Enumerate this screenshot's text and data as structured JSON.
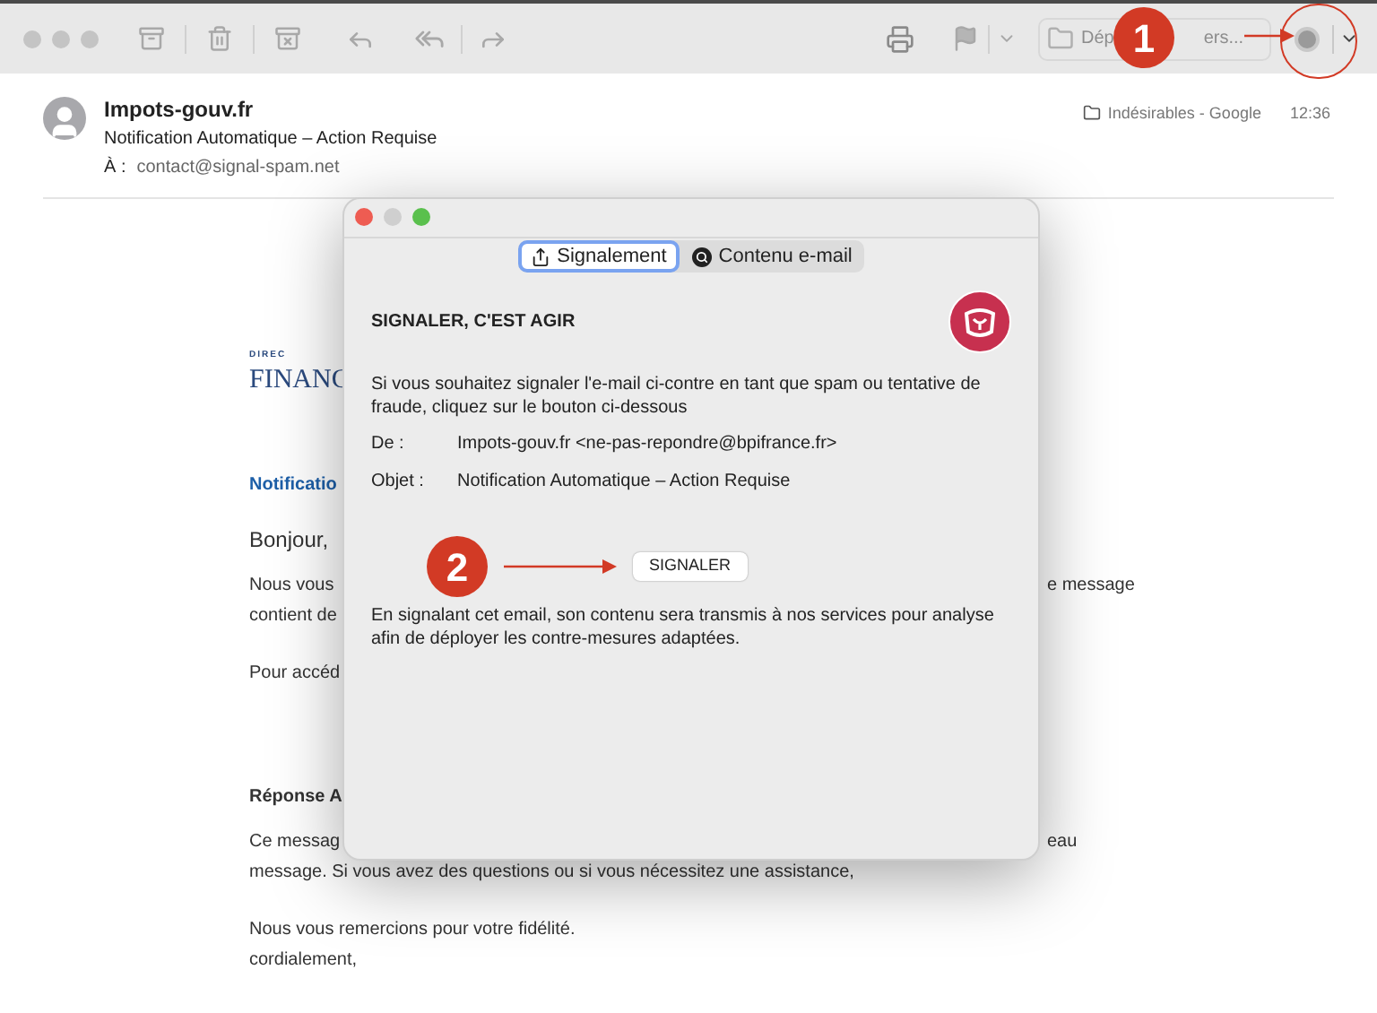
{
  "toolbar": {
    "move_field_start": "Dép",
    "move_field_end": "ers..."
  },
  "message": {
    "sender": "Impots-gouv.fr",
    "subject": "Notification Automatique – Action Requise",
    "to_label": "À :",
    "to": "contact@signal-spam.net",
    "folder": "Indésirables - Google",
    "time": "12:36"
  },
  "body": {
    "logo_top": "DIREC",
    "logo": "FINANC",
    "paragraphs": [
      {
        "kind": "link-heading",
        "lines": [
          {
            "left": "Notificatio"
          }
        ]
      },
      {
        "kind": "greeting",
        "lines": [
          {
            "left": "Bonjour,"
          }
        ]
      },
      {
        "kind": "text",
        "lines": [
          {
            "left": "Nous vous",
            "right": "e message"
          },
          {
            "left": "contient de"
          }
        ]
      },
      {
        "kind": "text",
        "lines": [
          {
            "left": "Pour accéd"
          }
        ]
      },
      {
        "kind": "bold",
        "lines": [
          {
            "left": "Réponse A"
          }
        ]
      },
      {
        "kind": "text",
        "lines": [
          {
            "left": "Ce messag",
            "right": "eau"
          },
          {
            "left": "message. Si vous avez des questions ou si vous nécessitez une assistance,"
          }
        ]
      },
      {
        "kind": "text",
        "lines": [
          {
            "left": "Nous vous remercions pour votre fidélité."
          },
          {
            "left": "cordialement,"
          }
        ]
      }
    ]
  },
  "dialog": {
    "tabs": [
      {
        "label": "Signalement",
        "selected": true,
        "kind": "share"
      },
      {
        "label": "Contenu e-mail",
        "selected": false,
        "kind": "search"
      }
    ],
    "title": "SIGNALER, C'EST AGIR",
    "intro": "Si vous souhaitez signaler l'e-mail ci-contre en tant que spam ou tentative de fraude, cliquez sur le bouton ci-dessous",
    "fields": [
      {
        "label": "De :",
        "value": "Impots-gouv.fr <ne-pas-repondre@bpifrance.fr>"
      },
      {
        "label": "Objet :",
        "value": "Notification Automatique – Action Requise"
      }
    ],
    "button": "SIGNALER",
    "note": "En signalant cet email, son contenu sera transmis à nos services pour analyse afin de déployer les contre-mesures adaptées."
  },
  "annotations": [
    {
      "label": "1"
    },
    {
      "label": "2"
    }
  ]
}
